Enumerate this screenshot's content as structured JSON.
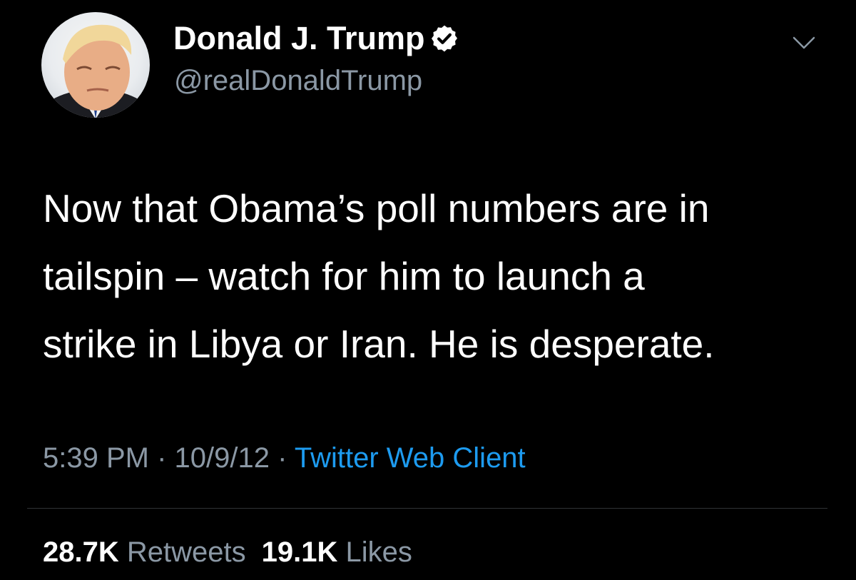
{
  "tweet": {
    "author": {
      "display_name": "Donald J. Trump",
      "handle": "@realDonaldTrump",
      "verified_icon": "verified-badge-icon",
      "avatar": "profile-photo"
    },
    "menu_icon": "chevron-down-icon",
    "text": "Now that Obama’s poll numbers are in\ntailspin – watch for him to launch a\nstrike in Libya or Iran.  He is desperate.",
    "time": "5:39 PM",
    "date": "10/9/12",
    "separator": "·",
    "source": "Twitter Web Client",
    "stats": {
      "retweets_count": "28.7K",
      "retweets_label": "Retweets",
      "likes_count": "19.1K",
      "likes_label": "Likes"
    }
  },
  "colors": {
    "background": "#000000",
    "primary_text": "#ffffff",
    "secondary_text": "#8b98a5",
    "link": "#1d9bf0",
    "divider": "#2f3336"
  }
}
